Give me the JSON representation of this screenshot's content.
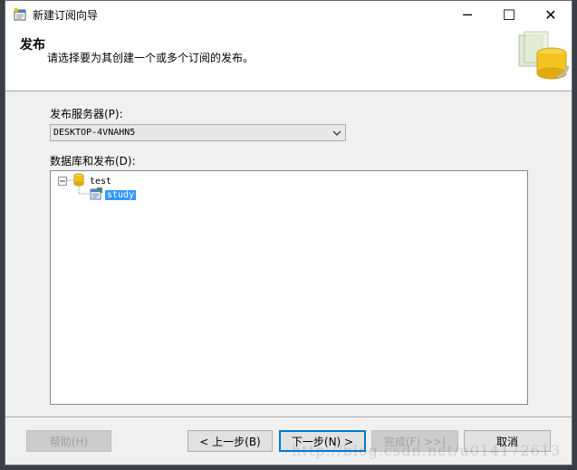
{
  "window": {
    "title": "新建订阅向导",
    "controls": {
      "minimize": "─",
      "maximize": "☐",
      "close": "✕"
    }
  },
  "header": {
    "title": "发布",
    "description": "请选择要为其创建一个或多个订阅的发布。",
    "art_icon": "wizard-database-icon"
  },
  "publisher": {
    "label": "发布服务器(P):",
    "value": "DESKTOP-4VNAHN5"
  },
  "databases": {
    "label": "数据库和发布(D):",
    "tree": {
      "database": "test",
      "publication": "study"
    }
  },
  "buttons": {
    "help": "帮助(H)",
    "back": "< 上一步(B)",
    "next": "下一步(N) >",
    "finish": "完成(F) >>|",
    "cancel": "取消"
  },
  "watermark": "http://blog.csdn.net/u014172613",
  "colors": {
    "selection": "#3399ff",
    "default_button_border": "#0078d7"
  }
}
